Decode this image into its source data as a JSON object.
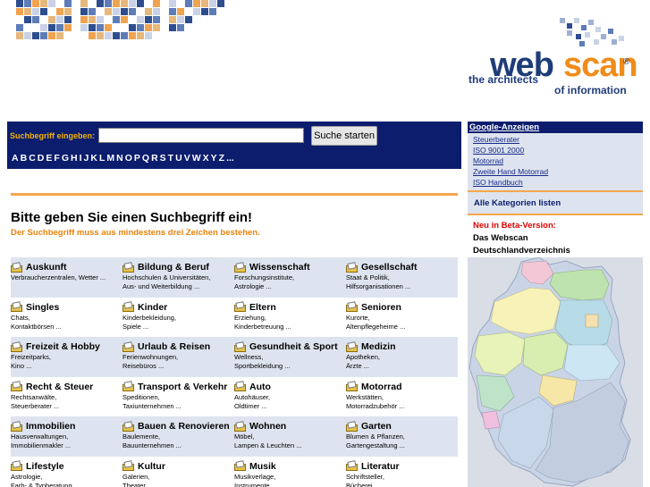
{
  "header": {
    "logo_web": "web",
    "logo_scan": "scan",
    "logo_reg": "®",
    "tagline_1": "the architects",
    "tagline_2": "of information"
  },
  "search": {
    "label": "Suchbegriff eingeben:",
    "value": "",
    "button_label": "Suche starten",
    "alphabet": [
      "A",
      "B",
      "C",
      "D",
      "E",
      "F",
      "G",
      "H",
      "I",
      "J",
      "K",
      "L",
      "M",
      "N",
      "O",
      "P",
      "Q",
      "R",
      "S",
      "T",
      "U",
      "V",
      "W",
      "X",
      "Y",
      "Z",
      "..."
    ]
  },
  "main": {
    "heading": "Bitte geben Sie einen Suchbegriff ein!",
    "subheading": "Der Suchbegriff muss aus mindestens drei Zeichen bestehen."
  },
  "categories": [
    [
      {
        "title": "Auskunft",
        "sub1": "Verbraucherzentralen, Wetter ...",
        "sub2": ""
      },
      {
        "title": "Bildung & Beruf",
        "sub1": "Hochschulen & Universitäten,",
        "sub2": "Aus- und Weiterbildung ..."
      },
      {
        "title": "Wissenschaft",
        "sub1": "Forschungsinstitute,",
        "sub2": "Astrologie ..."
      },
      {
        "title": "Gesellschaft",
        "sub1": "Staat & Politik,",
        "sub2": "Hilfsorganisationen ..."
      }
    ],
    [
      {
        "title": "Singles",
        "sub1": "Chats,",
        "sub2": "Kontaktbörsen ..."
      },
      {
        "title": "Kinder",
        "sub1": "Kinderbekleidung,",
        "sub2": "Spiele ..."
      },
      {
        "title": "Eltern",
        "sub1": "Erziehung,",
        "sub2": "Kinderbetreuung ..."
      },
      {
        "title": "Senioren",
        "sub1": "Kurorte,",
        "sub2": "Altenpflegeheime ..."
      }
    ],
    [
      {
        "title": "Freizeit & Hobby",
        "sub1": "Freizeitparks,",
        "sub2": "Kino ..."
      },
      {
        "title": "Urlaub & Reisen",
        "sub1": "Ferienwohnungen,",
        "sub2": "Reisebüros ..."
      },
      {
        "title": "Gesundheit & Sport",
        "sub1": "Wellness,",
        "sub2": "Sportbekleidung ..."
      },
      {
        "title": "Medizin",
        "sub1": "Apotheken,",
        "sub2": "Ärzte ..."
      }
    ],
    [
      {
        "title": "Recht & Steuer",
        "sub1": "Rechtsanwälte,",
        "sub2": "Steuerberater ..."
      },
      {
        "title": "Transport & Verkehr",
        "sub1": "Speditionen,",
        "sub2": "Taxiunternehmen ..."
      },
      {
        "title": "Auto",
        "sub1": "Autohäuser,",
        "sub2": "Oldtimer ..."
      },
      {
        "title": "Motorrad",
        "sub1": "Werkstätten,",
        "sub2": "Motorradzubehör ..."
      }
    ],
    [
      {
        "title": "Immobilien",
        "sub1": "Hausverwaltungen,",
        "sub2": "Immobilienmakler ..."
      },
      {
        "title": "Bauen & Renovieren",
        "sub1": "Baulemente,",
        "sub2": "Bauunternehmen ..."
      },
      {
        "title": "Wohnen",
        "sub1": "Möbel,",
        "sub2": "Lampen & Leuchten ..."
      },
      {
        "title": "Garten",
        "sub1": "Blumen & Pflanzen,",
        "sub2": "Gartengestaltung ..."
      }
    ],
    [
      {
        "title": "Lifestyle",
        "sub1": "Astrologie,",
        "sub2": "Farb- & Typberatung ..."
      },
      {
        "title": "Kultur",
        "sub1": "Galerien,",
        "sub2": "Theater ..."
      },
      {
        "title": "Musik",
        "sub1": "Musikverlage,",
        "sub2": "Instrumente ..."
      },
      {
        "title": "Literatur",
        "sub1": "Schriftsteller,",
        "sub2": "Bücherei ..."
      }
    ]
  ],
  "sidebar": {
    "ads_title": "Google-Anzeigen",
    "ads": [
      "Steuerberater",
      "ISO 9001 2000",
      "Motorrad",
      "Zweite Hand Motorrad",
      "ISO Handbuch"
    ],
    "all_categories": "Alle Kategorien listen",
    "beta_label": "Neu in Beta-Version:",
    "beta_line1": "Das Webscan",
    "beta_line2": "Deutschlandverzeichnis"
  },
  "colors": {
    "navy": "#0c1d6e",
    "orange": "#f6a64c",
    "shade": "#dde4ef",
    "highlight": "#e8830c"
  }
}
